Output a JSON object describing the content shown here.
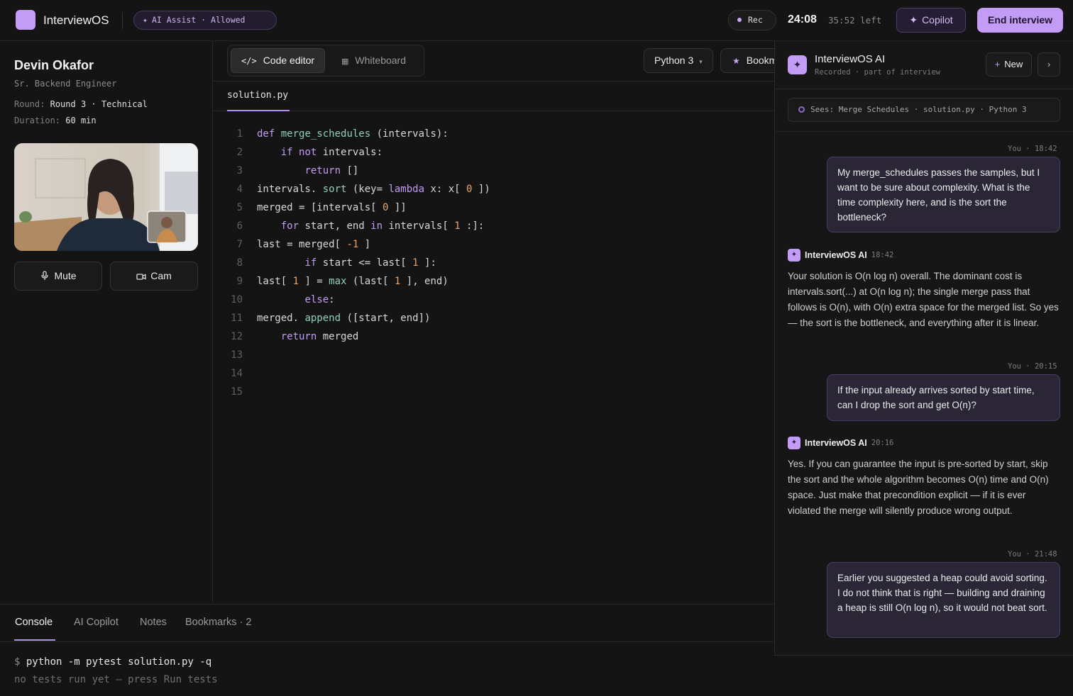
{
  "app": {
    "name": "InterviewOS",
    "ai_assist_badge": "AI Assist · Allowed"
  },
  "topbar": {
    "rec_label": "Rec",
    "elapsed": "24:08",
    "remaining": "35:52 left",
    "copilot_label": "Copilot",
    "end_label": "End interview"
  },
  "candidate": {
    "name": "Devin Okafor",
    "role": "Sr. Backend Engineer",
    "round_label": "Round:",
    "round_value": "Round 3 · Technical",
    "duration_label": "Duration:",
    "duration_value": "60 min",
    "mute_label": "Mute",
    "cam_label": "Cam"
  },
  "editor": {
    "tabs": [
      {
        "label": "Code editor",
        "active": true
      },
      {
        "label": "Whiteboard",
        "active": false
      }
    ],
    "language": "Python 3",
    "bookmark_label": "Bookm",
    "file": "solution.py",
    "line_numbers": [
      "1",
      "2",
      "3",
      "4",
      "5",
      "6",
      "7",
      "8",
      "9",
      "10",
      "11",
      "12",
      "13",
      "14",
      "15"
    ]
  },
  "copilot": {
    "title": "InterviewOS AI",
    "subtitle": "Recorded · part of interview",
    "new_label": "New",
    "context": "Sees: Merge Schedules · solution.py · Python 3",
    "you_label": "You",
    "ai_name": "InterviewOS AI",
    "messages": [
      {
        "role": "you",
        "time": "18:42",
        "text": "My merge_schedules passes the samples, but I want to be sure about complexity. What is the time complexity here, and is the sort the bottleneck?"
      },
      {
        "role": "ai",
        "time": "18:42",
        "text": "Your solution is O(n log n) overall. The dominant cost is intervals.sort(...) at O(n log n); the single merge pass that follows is O(n), with O(n) extra space for the merged list. So yes — the sort is the bottleneck, and everything after it is linear."
      },
      {
        "role": "you",
        "time": "20:15",
        "text": "If the input already arrives sorted by start time, can I drop the sort and get O(n)?"
      },
      {
        "role": "ai",
        "time": "20:16",
        "text": "Yes. If you can guarantee the input is pre-sorted by start, skip the sort and the whole algorithm becomes O(n) time and O(n) space. Just make that precondition explicit — if it is ever violated the merge will silently produce wrong output."
      },
      {
        "role": "you",
        "time": "21:48",
        "text": "Earlier you suggested a heap could avoid sorting. I do not think that is right — building and draining a heap is still O(n log n), so it would not beat sort."
      }
    ]
  },
  "bottom": {
    "tabs": [
      "Console",
      "AI Copilot",
      "Notes",
      "Bookmarks · 2"
    ],
    "prompt": "$",
    "command": "python -m pytest solution.py -q",
    "output": "no tests run yet — press Run tests"
  },
  "colors": {
    "accent": "#c39cf5",
    "background": "#141414",
    "keyword": "#c39cf5",
    "function": "#8fd0bd",
    "number": "#e7a36b"
  },
  "icons": [
    "sparkle-icon",
    "record-dot-icon",
    "mic-icon",
    "camera-icon",
    "code-icon",
    "whiteboard-icon",
    "star-icon",
    "plus-icon",
    "chevron-right-icon",
    "context-ring-icon"
  ]
}
